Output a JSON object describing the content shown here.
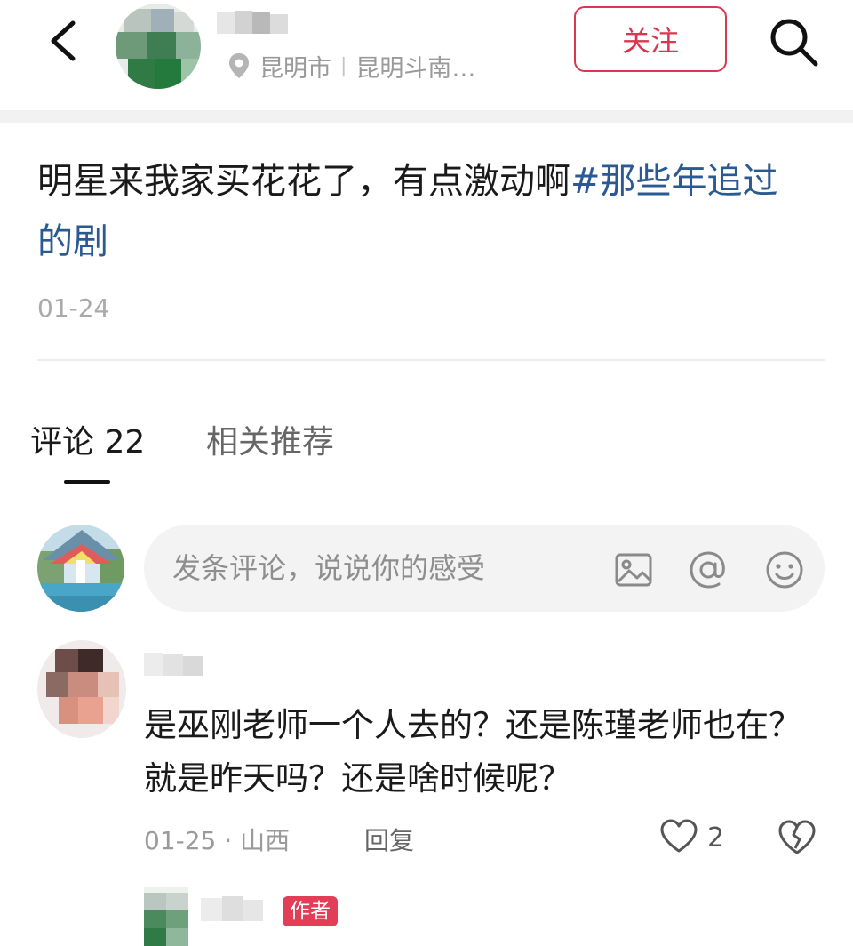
{
  "header": {
    "location_city": "昆明市",
    "location_separator": "|",
    "location_place": "昆明斗南…",
    "follow_label": "关注",
    "icons": [
      "back-icon",
      "location-pin-icon",
      "search-icon"
    ]
  },
  "post": {
    "text": "明星来我家买花花了，有点激动啊",
    "topic": "#那些年追过的剧",
    "date": "01-24"
  },
  "tabs": [
    {
      "label": "评论 22",
      "active": true
    },
    {
      "label": "相关推荐",
      "active": false
    }
  ],
  "comment_input": {
    "placeholder": "发条评论，说说你的感受",
    "icons": [
      "image-icon",
      "mention-icon",
      "emoji-icon"
    ]
  },
  "comments": [
    {
      "text": "是巫刚老师一个人去的？还是陈瑾老师也在？就是昨天吗？还是啥时候呢？",
      "meta": "01-25 · 山西",
      "reply_label": "回复",
      "like_count": "2"
    }
  ],
  "reply": {
    "badge": "作者"
  },
  "colors": {
    "accent_red": "#d9364f",
    "topic_blue": "#2b5a92",
    "badge_red": "#e23e57"
  }
}
